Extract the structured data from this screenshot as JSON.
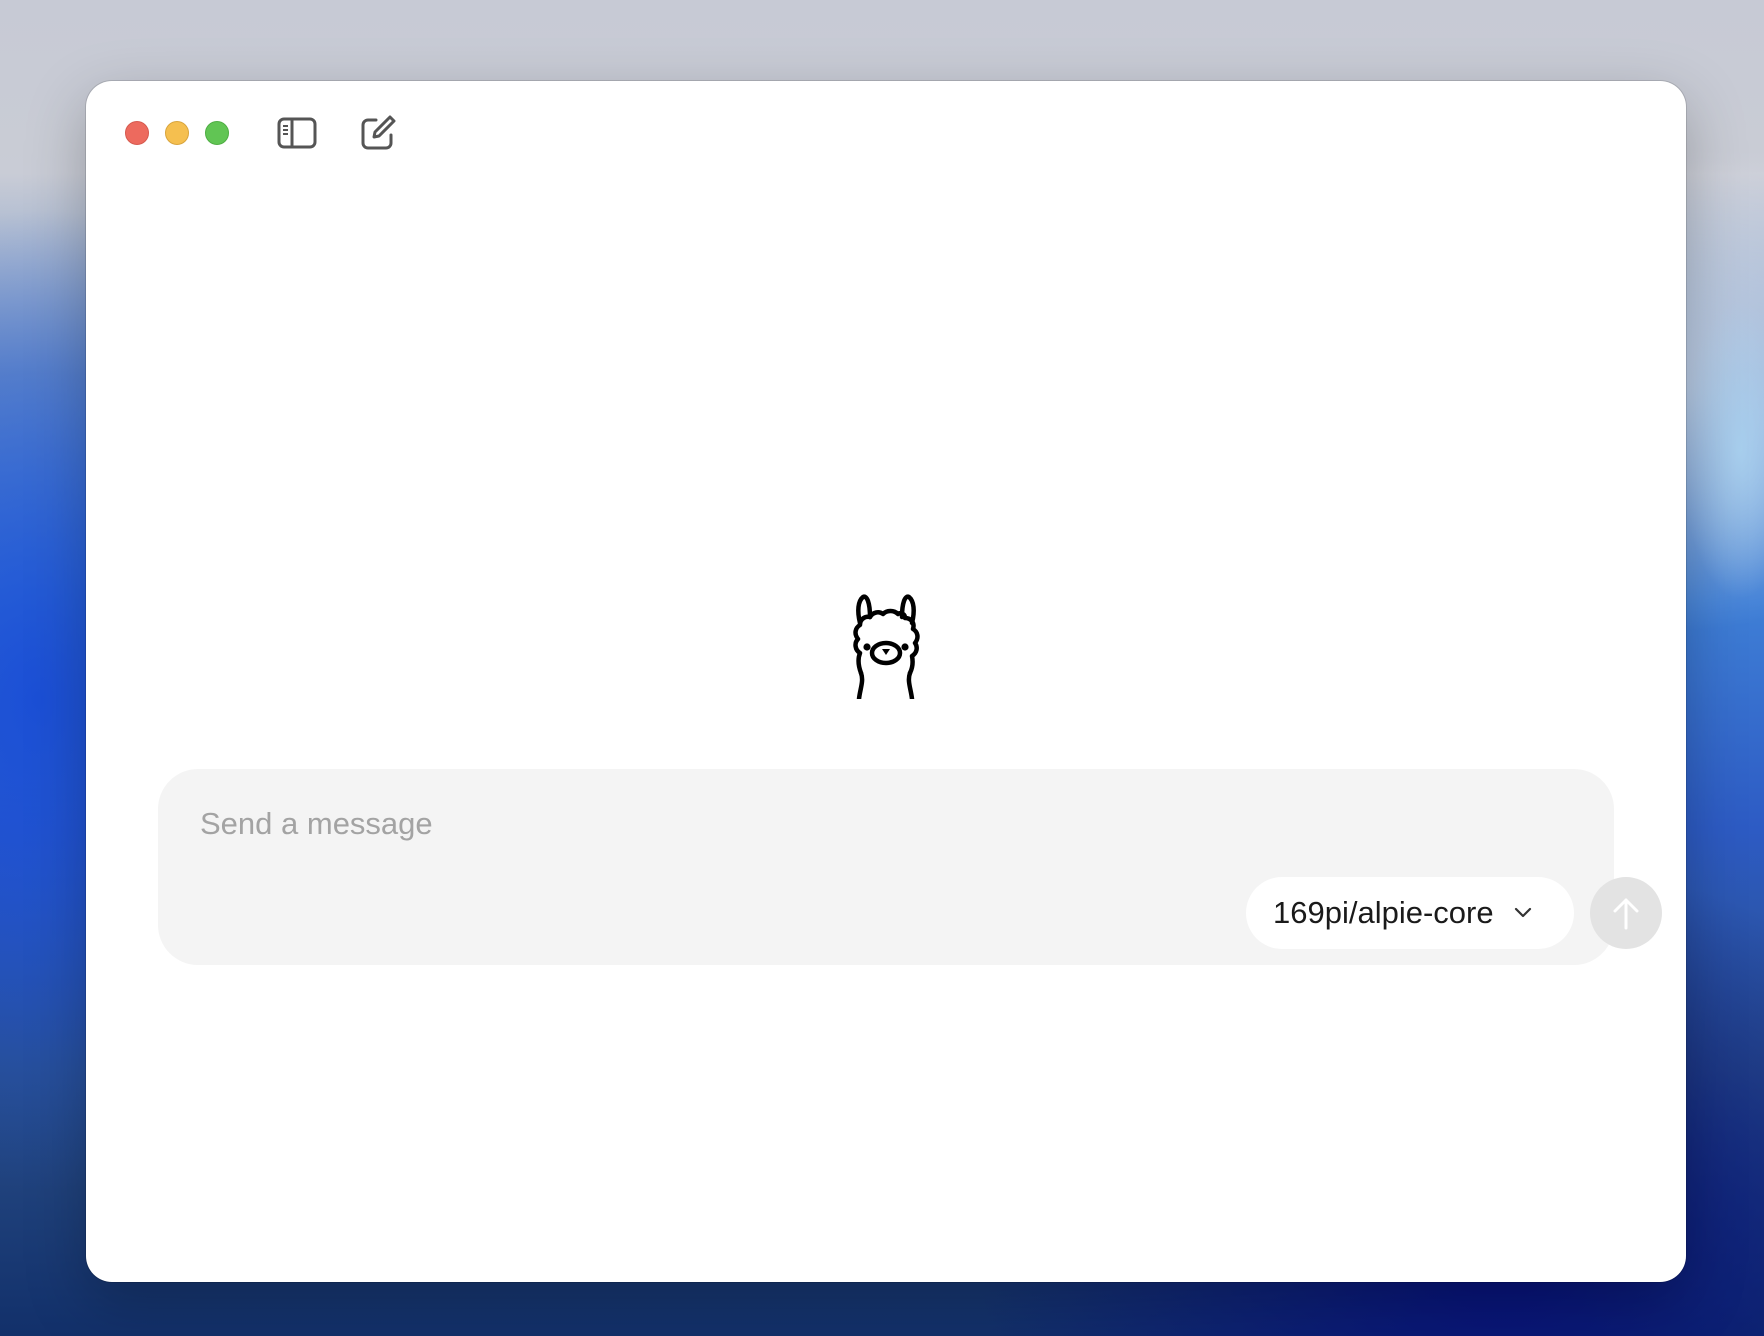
{
  "window": {
    "controls": {
      "close": "close-window",
      "minimize": "minimize-window",
      "zoom": "zoom-window"
    },
    "toolbar": {
      "sidebar_icon": "sidebar-toggle-icon",
      "new_chat_icon": "new-chat-compose-icon"
    }
  },
  "main": {
    "logo_icon": "llama-mascot-icon"
  },
  "composer": {
    "placeholder": "Send a message",
    "value": "",
    "model": {
      "selected": "169pi/alpie-core",
      "chevron_icon": "chevron-down-icon"
    },
    "send_icon": "arrow-up-icon"
  },
  "colors": {
    "close": "#ed6a5e",
    "minimize": "#f5bf4f",
    "zoom": "#61c554",
    "composer_bg": "#f4f4f4",
    "send_disabled": "#e3e3e3",
    "placeholder": "#a3a3a3"
  }
}
